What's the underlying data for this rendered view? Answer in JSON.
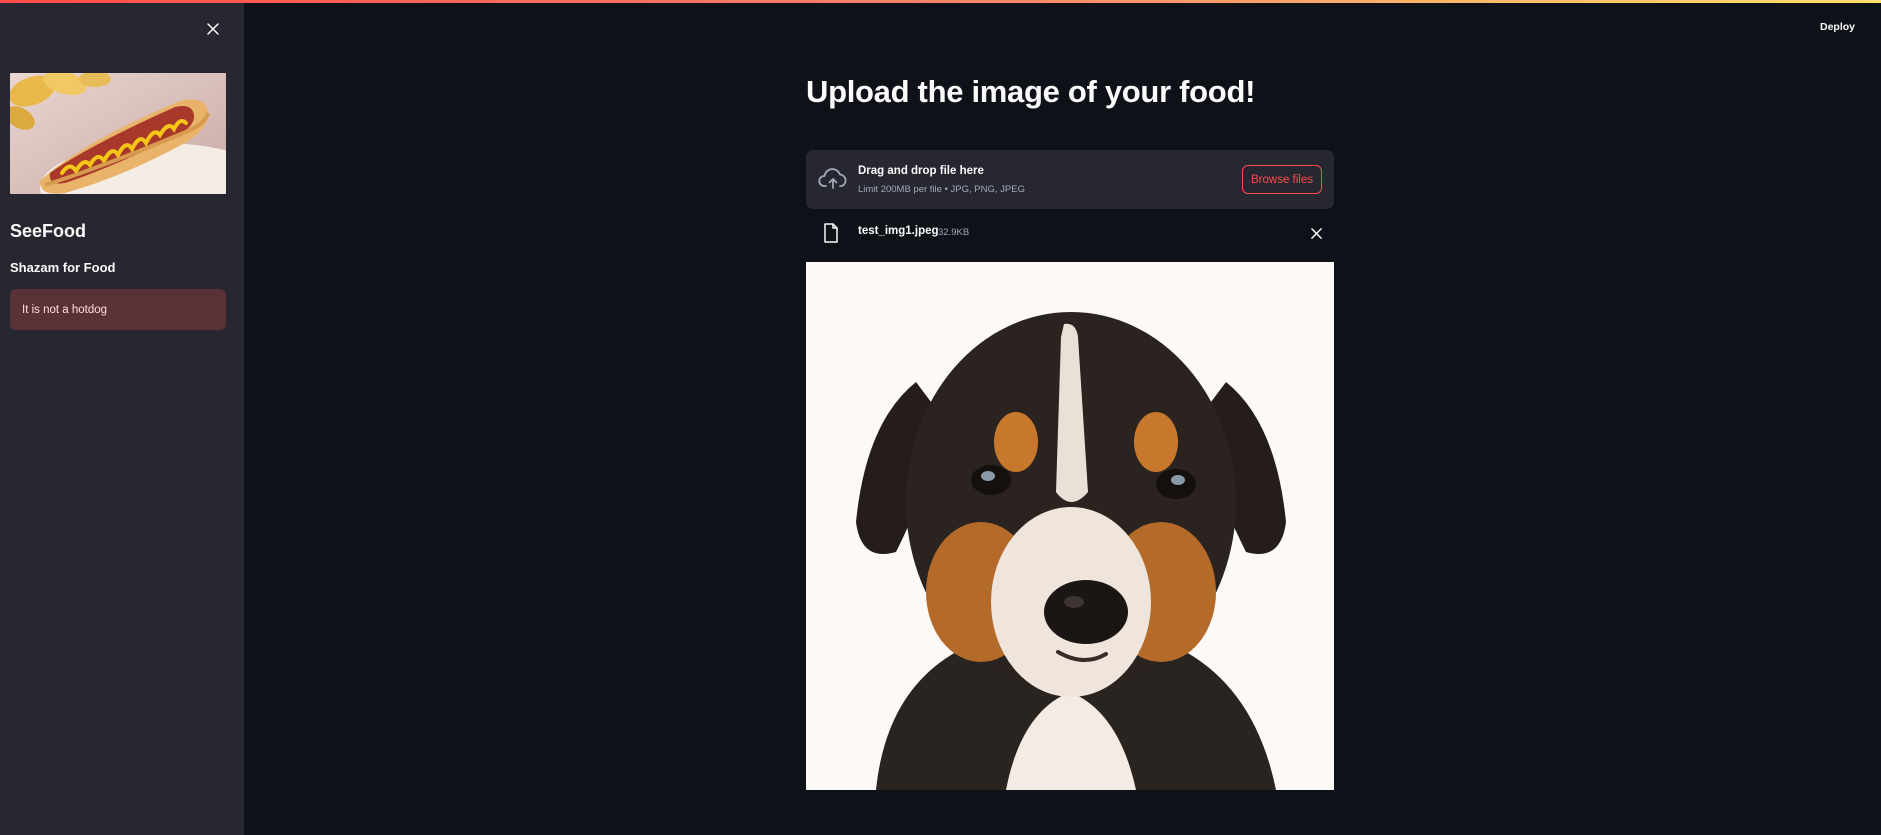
{
  "sidebar": {
    "title": "SeeFood",
    "subtitle": "Shazam for Food",
    "alert": "It is not a hotdog",
    "image_icon": "hotdog-image"
  },
  "header": {
    "deploy_label": "Deploy"
  },
  "main": {
    "title": "Upload the image of your food!",
    "uploader": {
      "instruction": "Drag and drop file here",
      "limit": "Limit 200MB per file • JPG, PNG, JPEG",
      "browse_label": "Browse files"
    },
    "file": {
      "name": "test_img1.jpeg",
      "size": "32.9KB"
    },
    "image_icon": "puppy-photo"
  },
  "colors": {
    "accent": "#ff4b4b",
    "sidebar_bg": "#262730",
    "main_bg": "#0e1117",
    "alert_bg": "#5b3138"
  }
}
